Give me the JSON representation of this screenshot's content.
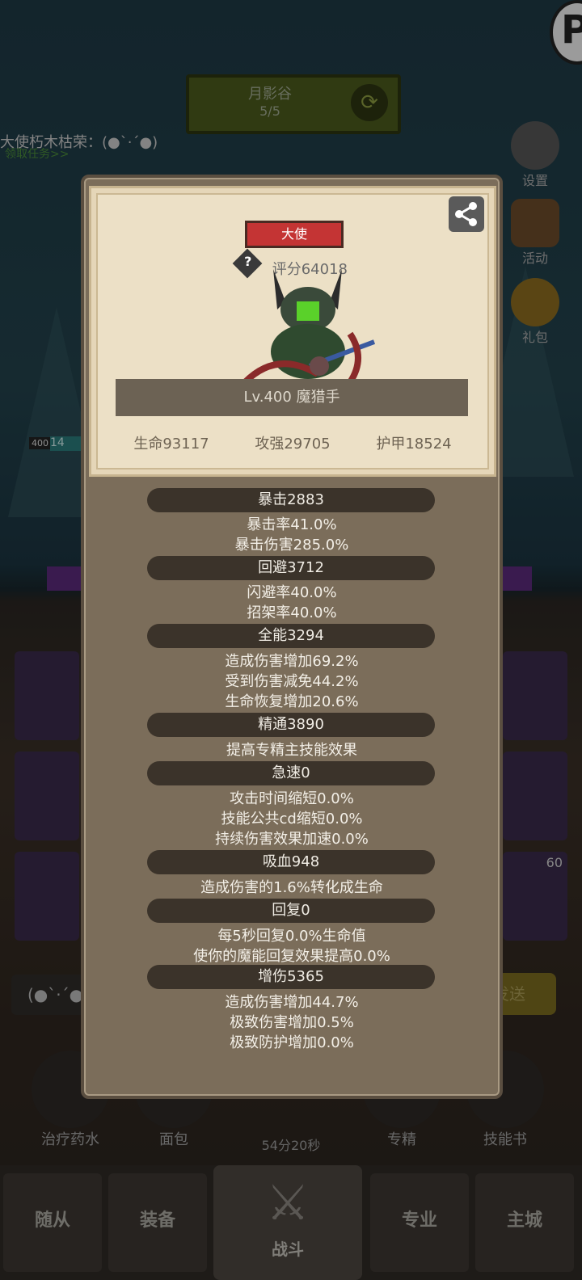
{
  "background": {
    "stage_name": "月影谷",
    "stage_count": "5/5",
    "player_line": "大使朽木枯荣：(●`·´●)",
    "task_line": "领取任务>>",
    "level_badge": "400",
    "hp_badge": "14",
    "side_buttons": [
      "设置",
      "活动",
      "礼包"
    ],
    "chat_text": "(●`·´●",
    "send_label": "发送",
    "bottom_items": [
      "治疗药水",
      "面包",
      "专精",
      "技能书"
    ],
    "timer": "54分20秒",
    "slot_badge": "60",
    "tabs": [
      "随从",
      "装备",
      "战斗",
      "专业",
      "主城"
    ]
  },
  "modal": {
    "role": "大使",
    "score": "评分64018",
    "name_line": "Lv.400 魔猎手",
    "top_stats": [
      "生命93117",
      "攻强29705",
      "护甲18524"
    ],
    "sections": [
      {
        "title": "暴击2883",
        "lines": [
          "暴击率41.0%",
          "暴击伤害285.0%"
        ]
      },
      {
        "title": "回避3712",
        "lines": [
          "闪避率40.0%",
          "招架率40.0%"
        ]
      },
      {
        "title": "全能3294",
        "lines": [
          "造成伤害增加69.2%",
          "受到伤害减免44.2%",
          "生命恢复增加20.6%"
        ]
      },
      {
        "title": "精通3890",
        "lines": [
          "提高专精主技能效果"
        ]
      },
      {
        "title": "急速0",
        "lines": [
          "攻击时间缩短0.0%",
          "技能公共cd缩短0.0%",
          "持续伤害效果加速0.0%"
        ]
      },
      {
        "title": "吸血948",
        "lines": [
          "造成伤害的1.6%转化成生命"
        ]
      },
      {
        "title": "回复0",
        "lines": [
          "每5秒回复0.0%生命值",
          "使你的魔能回复效果提高0.0%"
        ]
      },
      {
        "title": "增伤5365",
        "lines": [
          "造成伤害增加44.7%",
          "极致伤害增加0.5%",
          "极致防护增加0.0%"
        ]
      }
    ]
  },
  "colors": {
    "role_badge": "#c43434",
    "panel": "#7b6d5a",
    "card": "#ece0c6"
  },
  "icons": [
    "share-icon",
    "help-icon",
    "refresh-icon",
    "settings-icon",
    "activity-icon",
    "gift-icon",
    "swords-icon"
  ]
}
